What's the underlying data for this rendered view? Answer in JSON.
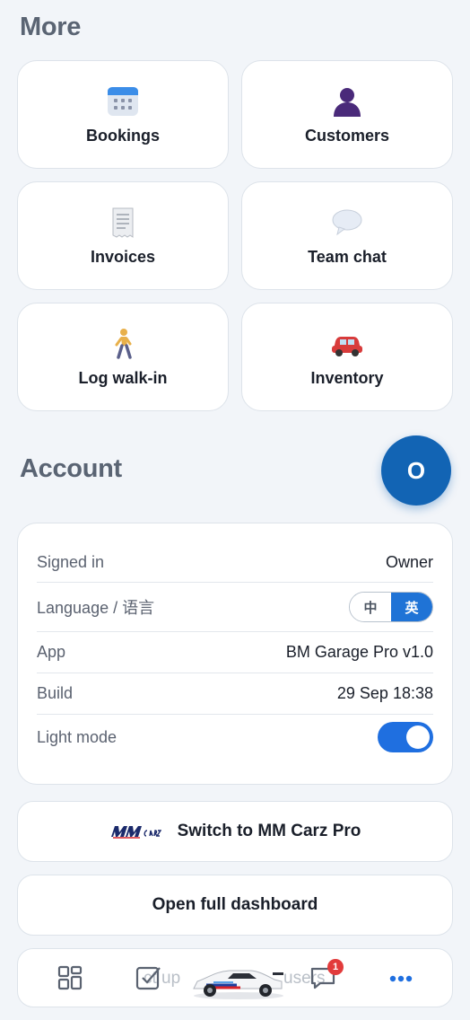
{
  "more": {
    "title": "More",
    "tiles": [
      {
        "label": "Bookings",
        "icon": "calendar-icon"
      },
      {
        "label": "Customers",
        "icon": "person-icon"
      },
      {
        "label": "Invoices",
        "icon": "receipt-icon"
      },
      {
        "label": "Team chat",
        "icon": "speech-bubble-icon"
      },
      {
        "label": "Log walk-in",
        "icon": "walking-person-icon"
      },
      {
        "label": "Inventory",
        "icon": "car-icon"
      }
    ]
  },
  "account": {
    "title": "Account",
    "avatar_initial": "O",
    "rows": {
      "signed_in": {
        "label": "Signed in",
        "value": "Owner"
      },
      "language": {
        "label": "Language / 语言",
        "options": [
          "中",
          "英"
        ],
        "selected": "英"
      },
      "app": {
        "label": "App",
        "value": "BM Garage Pro v1.0"
      },
      "build": {
        "label": "Build",
        "value": "29 Sep 18:38"
      },
      "light_mode": {
        "label": "Light mode",
        "enabled": true
      }
    }
  },
  "actions": {
    "switch_label": "Switch to MM Carz Pro",
    "dashboard_label": "Open full dashboard"
  },
  "bottom_nav": {
    "obscured_text_left": "ct up",
    "obscured_text_right": "users",
    "chat_badge": "1",
    "items": [
      "grid-icon",
      "checkbox-icon",
      "chat-icon",
      "more-dots-icon"
    ]
  },
  "colors": {
    "accent": "#1f6fe0",
    "fab": "#1264b4",
    "badge": "#e23b3b",
    "background": "#f2f5f9"
  }
}
